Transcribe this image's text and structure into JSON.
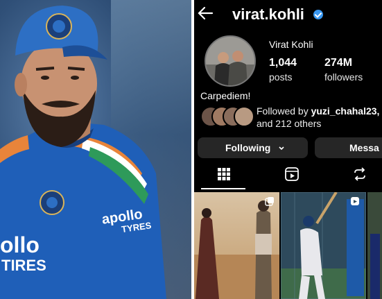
{
  "left_photo": {
    "jersey_text_1": "apollo",
    "jersey_text_2": "TYRES",
    "chest_text_1": "ollo",
    "chest_text_2": "TIRES"
  },
  "profile": {
    "username": "virat.kohli",
    "display_name": "Virat Kohli",
    "posts_count": "1,044",
    "posts_label": "posts",
    "followers_count": "274M",
    "followers_label": "followers",
    "bio": "Carpediem!",
    "followed_by_prefix": "Followed by",
    "followed_by_user": "yuzi_chahal23,",
    "followed_by_suffix": "and 212 others"
  },
  "buttons": {
    "following": "Following",
    "message": "Messa"
  },
  "icons": {
    "back": "back-arrow-icon",
    "verified": "verified-badge-icon",
    "grid": "grid-icon",
    "reels": "reels-icon",
    "reposts": "reposts-icon"
  },
  "colors": {
    "background": "#000000",
    "button": "#262626",
    "verified": "#3897f0",
    "jersey_blue": "#1f5fb8"
  }
}
